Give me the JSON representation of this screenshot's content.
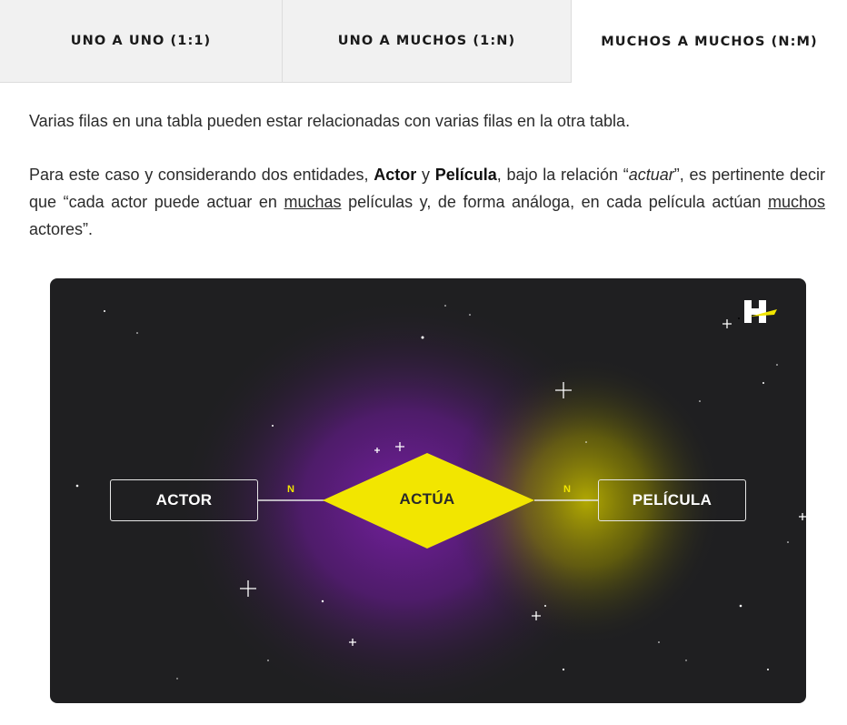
{
  "tabs": [
    {
      "label": "UNO A UNO (1:1)",
      "active": false
    },
    {
      "label": "UNO A MUCHOS (1:N)",
      "active": false
    },
    {
      "label": "MUCHOS A MUCHOS (N:M)",
      "active": true
    }
  ],
  "content": {
    "intro": "Varias filas en una tabla pueden estar relacionadas con varias filas en la otra tabla.",
    "example": {
      "part1": "Para este caso y considerando dos entidades, ",
      "entity1": "Actor",
      "part2": " y ",
      "entity2": "Película",
      "part3": ", bajo la relación “",
      "relation": "actuar",
      "part4": "”, es pertinente decir que “cada actor puede actuar en ",
      "muchas": "muchas",
      "part5": " películas y, de forma análoga, en cada película actúan ",
      "muchos": "muchos",
      "part6": " actores”."
    }
  },
  "diagram": {
    "entity_left": "ACTOR",
    "relationship": "ACTÚA",
    "entity_right": "PELÍCULA",
    "cardinality_left": "N",
    "cardinality_right": "N",
    "logo_icon": "brand-h-logo-icon",
    "colors": {
      "background": "#1f1f21",
      "diamond": "#f2e600",
      "glow_purple": "#7a1fa8",
      "glow_yellow": "#b9b000",
      "cardinality": "#f2e600"
    }
  }
}
